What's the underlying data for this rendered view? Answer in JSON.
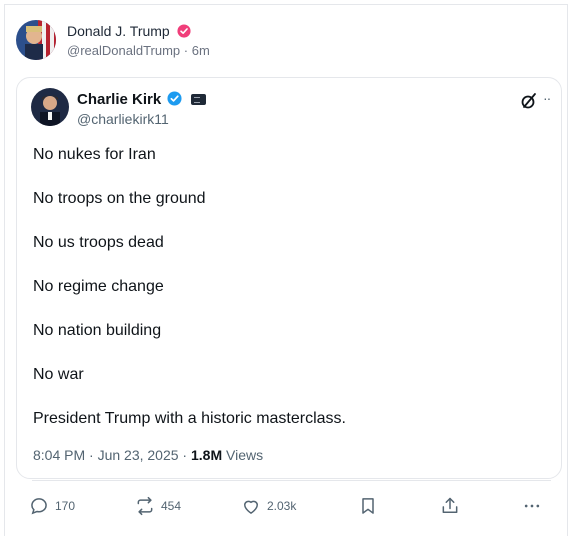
{
  "post": {
    "author_name": "Donald J. Trump",
    "handle": "@realDonaldTrump",
    "time": "· 6m"
  },
  "quote": {
    "author_name": "Charlie Kirk",
    "handle": "@charliekirk11",
    "more": "··",
    "lines": [
      "No nukes for Iran",
      "No troops on the ground",
      "No us troops dead",
      "No regime change",
      "No nation building",
      "No war",
      "President Trump with a historic masterclass."
    ],
    "timestamp": "8:04 PM · Jun 23, 2025 · ",
    "views_count": "1.8M",
    "views_label": " Views"
  },
  "actions": {
    "replies": "170",
    "reposts": "454",
    "likes": "2.03k"
  },
  "icons": {
    "reply": "reply-icon",
    "repost": "repost-icon",
    "like": "heart-icon",
    "bookmark": "bookmark-icon",
    "share": "share-icon",
    "more": "more-icon"
  },
  "colors": {
    "pink_badge": "#f03e7a",
    "blue_badge": "#1d9bf0"
  }
}
